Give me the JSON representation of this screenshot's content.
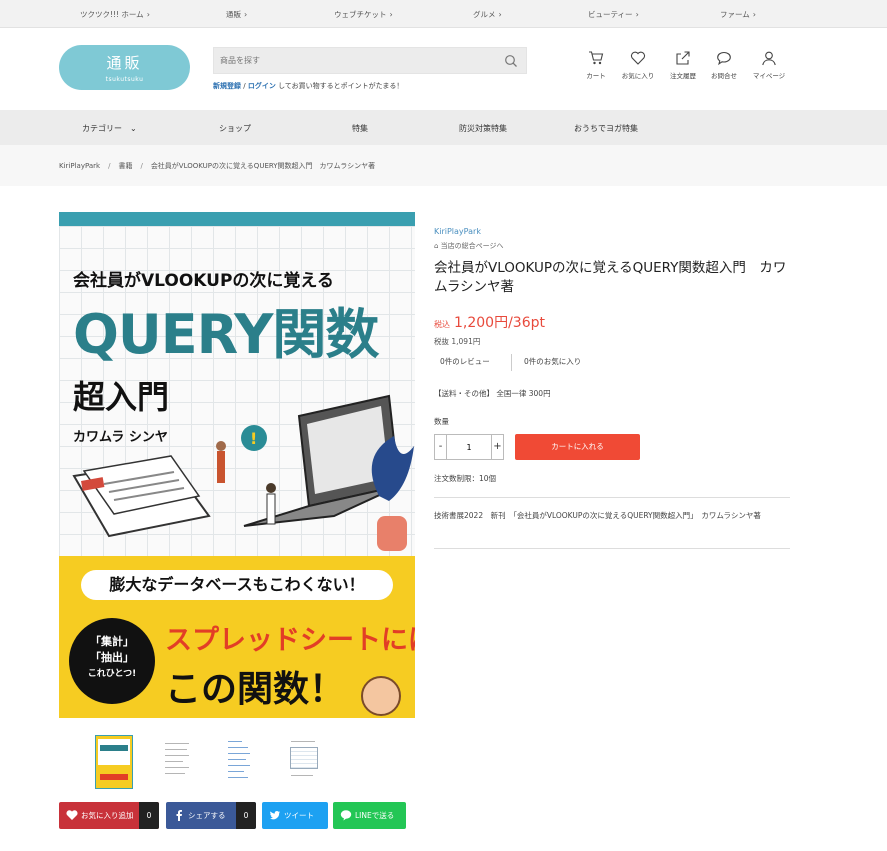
{
  "topbar": {
    "links": [
      "ツクツク!!! ホーム",
      "通販",
      "ウェブチケット",
      "グルメ",
      "ビューティー",
      "ファーム"
    ]
  },
  "header": {
    "logo_main": "通販",
    "logo_sub": "tsukutsuku",
    "search_placeholder": "商品を探す",
    "register": "新規登録",
    "slash": "/",
    "login": "ログイン",
    "register_note": "してお買い物するとポイントがたまる！",
    "icons": [
      {
        "label": "カート",
        "icon": "cart-icon"
      },
      {
        "label": "お気に入り",
        "icon": "heart-icon"
      },
      {
        "label": "注文履歴",
        "icon": "share-icon"
      },
      {
        "label": "お問合せ",
        "icon": "chat-icon"
      },
      {
        "label": "マイページ",
        "icon": "user-icon"
      }
    ]
  },
  "nav": {
    "items": [
      "カテゴリー",
      "ショップ",
      "特集",
      "防災対策特集",
      "おうちでヨガ特集"
    ]
  },
  "breadcrumb": {
    "items": [
      "KiriPlayPark",
      "書籍",
      "会社員がVLOOKUPの次に覚えるQUERY関数超入門　カワムラシンヤ著"
    ]
  },
  "cover": {
    "line1": "会社員がVLOOKUPの次に覚える",
    "line2": "QUERY関数",
    "line3": "超入門",
    "author": "カワムラ シンヤ",
    "banner": "膨大なデータベースもこわくない！",
    "circle1": "「集計」",
    "circle2": "「抽出」",
    "circle3": "これひとつ!",
    "big1": "スプレッドシートには",
    "big2": "この関数！"
  },
  "share": {
    "favorite_label": "お気に入り追加",
    "favorite_count": "0",
    "share_label": "シェアする",
    "share_count": "0",
    "tweet_label": "ツイート",
    "line_label": "LINEで送る"
  },
  "product": {
    "shop": "KiriPlayPark",
    "shop_link": "当店の総合ページへ",
    "title": "会社員がVLOOKUPの次に覚えるQUERY関数超入門　カワムラシンヤ著",
    "price_tax_label": "税込",
    "price": "1,200円/36pt",
    "price_ex": "税抜 1,091円",
    "reviews": "0件のレビュー",
    "favorites": "0件のお気に入り",
    "shipping": "【送料・その他】 全国一律 300円",
    "qty_label": "数量",
    "qty_value": "1",
    "minus": "-",
    "plus": "+",
    "cart_button": "カートに入れる",
    "order_limit": "注文数制限：10個",
    "description": "技術書展2022　新刊　「会社員がVLOOKUPの次に覚えるQUERY関数超入門」　カワムラシンヤ著"
  },
  "colors": {
    "accent": "#7fc9d5",
    "cart": "#f04a35",
    "price": "#e84a3c",
    "favorite_btn": "#c8323a",
    "share_btn": "#3b5998",
    "tweet_btn": "#1da1f2",
    "line_btn": "#23c655"
  }
}
